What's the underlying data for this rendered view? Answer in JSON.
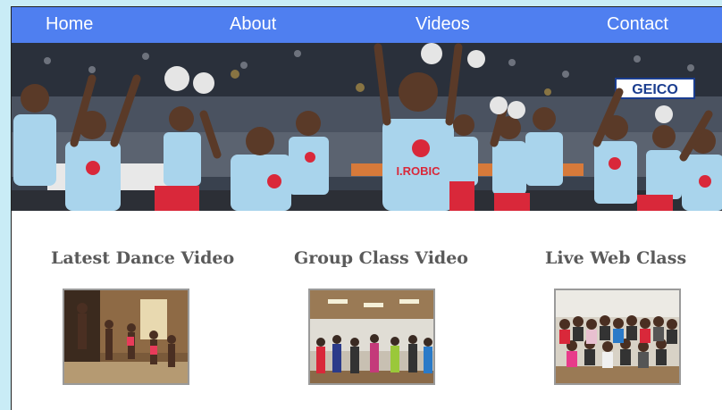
{
  "nav": {
    "items": [
      "Home",
      "About",
      "Videos",
      "Contact"
    ]
  },
  "hero": {
    "banner_text": "GEICO",
    "shirt_text": "I.ROBIC"
  },
  "sections": [
    {
      "title": "Latest Dance Video"
    },
    {
      "title": "Group Class Video"
    },
    {
      "title": "Live Web Class"
    }
  ],
  "colors": {
    "nav_bg": "#4f7ff0",
    "page_bg": "#ffffff",
    "outer_bg": "#c9ecf6",
    "title_text": "#5a5a5a"
  }
}
